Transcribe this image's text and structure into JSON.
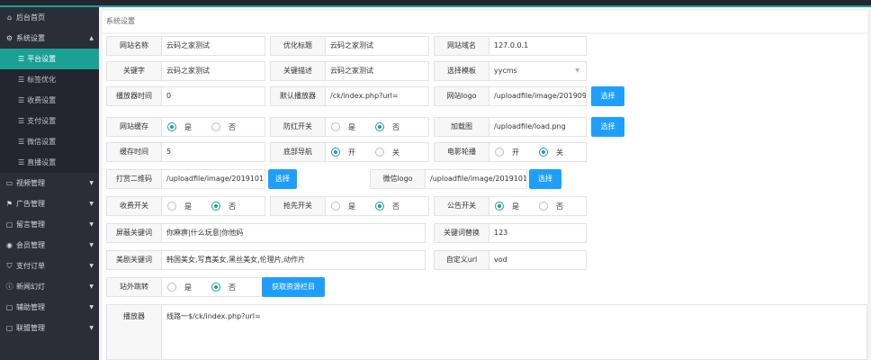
{
  "sidebar": {
    "home": "后台首页",
    "system": "系统设置",
    "system_subitems": [
      "平台设置",
      "标签优化",
      "收费设置",
      "支付设置",
      "微信设置",
      "直播设置"
    ],
    "menus": [
      "视频管理",
      "广告管理",
      "留言管理",
      "会员管理",
      "支付订单",
      "新闻幻灯",
      "辅助管理",
      "联盟管理"
    ]
  },
  "breadcrumb": "系统设置",
  "form": {
    "site_name": {
      "label": "网站名称",
      "value": "云码之家测试"
    },
    "seo_title": {
      "label": "优化标题",
      "value": "云码之家测试"
    },
    "site_domain": {
      "label": "网站域名",
      "value": "127.0.0.1"
    },
    "keywords": {
      "label": "关键字",
      "value": "云码之家测试"
    },
    "description": {
      "label": "关键描述",
      "value": "云码之家测试"
    },
    "template": {
      "label": "选择模板",
      "value": "yycms"
    },
    "player_time": {
      "label": "播放器时间",
      "value": "0"
    },
    "default_player": {
      "label": "默认播放器",
      "value": "/ck/index.php?url="
    },
    "site_logo": {
      "label": "网站logo",
      "value": "/uploadfile/image/20190928/"
    },
    "site_cache": {
      "label": "网站缓存",
      "yes": "是",
      "no": "否"
    },
    "anti_red": {
      "label": "防红开关",
      "yes": "是",
      "no": "否"
    },
    "loading_img": {
      "label": "加载图",
      "value": "/uploadfile/load.png"
    },
    "cache_time": {
      "label": "缓存时间",
      "value": "5"
    },
    "bottom_nav": {
      "label": "底部导航",
      "on": "开",
      "off": "关"
    },
    "movie_carousel": {
      "label": "电影轮播",
      "on": "开",
      "off": "关"
    },
    "reward_qr": {
      "label": "打赏二维码",
      "value": "/uploadfile/image/20191011/"
    },
    "wechat_logo": {
      "label": "微信logo",
      "value": "/uploadfile/image/20191014/"
    },
    "charge_switch": {
      "label": "收费开关",
      "yes": "是",
      "no": "否"
    },
    "grab_switch": {
      "label": "抢先开关",
      "yes": "是",
      "no": "否"
    },
    "notice_switch": {
      "label": "公告开关",
      "yes": "是",
      "no": "否"
    },
    "block_keywords": {
      "label": "屏蔽关键词",
      "value": "你麻痹|什么玩意|你他妈"
    },
    "keyword_replace": {
      "label": "关键词替换",
      "value": "123"
    },
    "drama_keywords": {
      "label": "美剧关键词",
      "value": "韩国美女,写真美女,黑丝美女,伦理片,动作片"
    },
    "custom_url": {
      "label": "自定义url",
      "value": "vod"
    },
    "external_jump": {
      "label": "站外跳转",
      "yes": "是",
      "no": "否"
    },
    "player": {
      "label": "播放器",
      "value": "线路一$/ck/index.php?url="
    }
  },
  "buttons": {
    "select": "选择",
    "get_resource": "获取资源栏目"
  }
}
